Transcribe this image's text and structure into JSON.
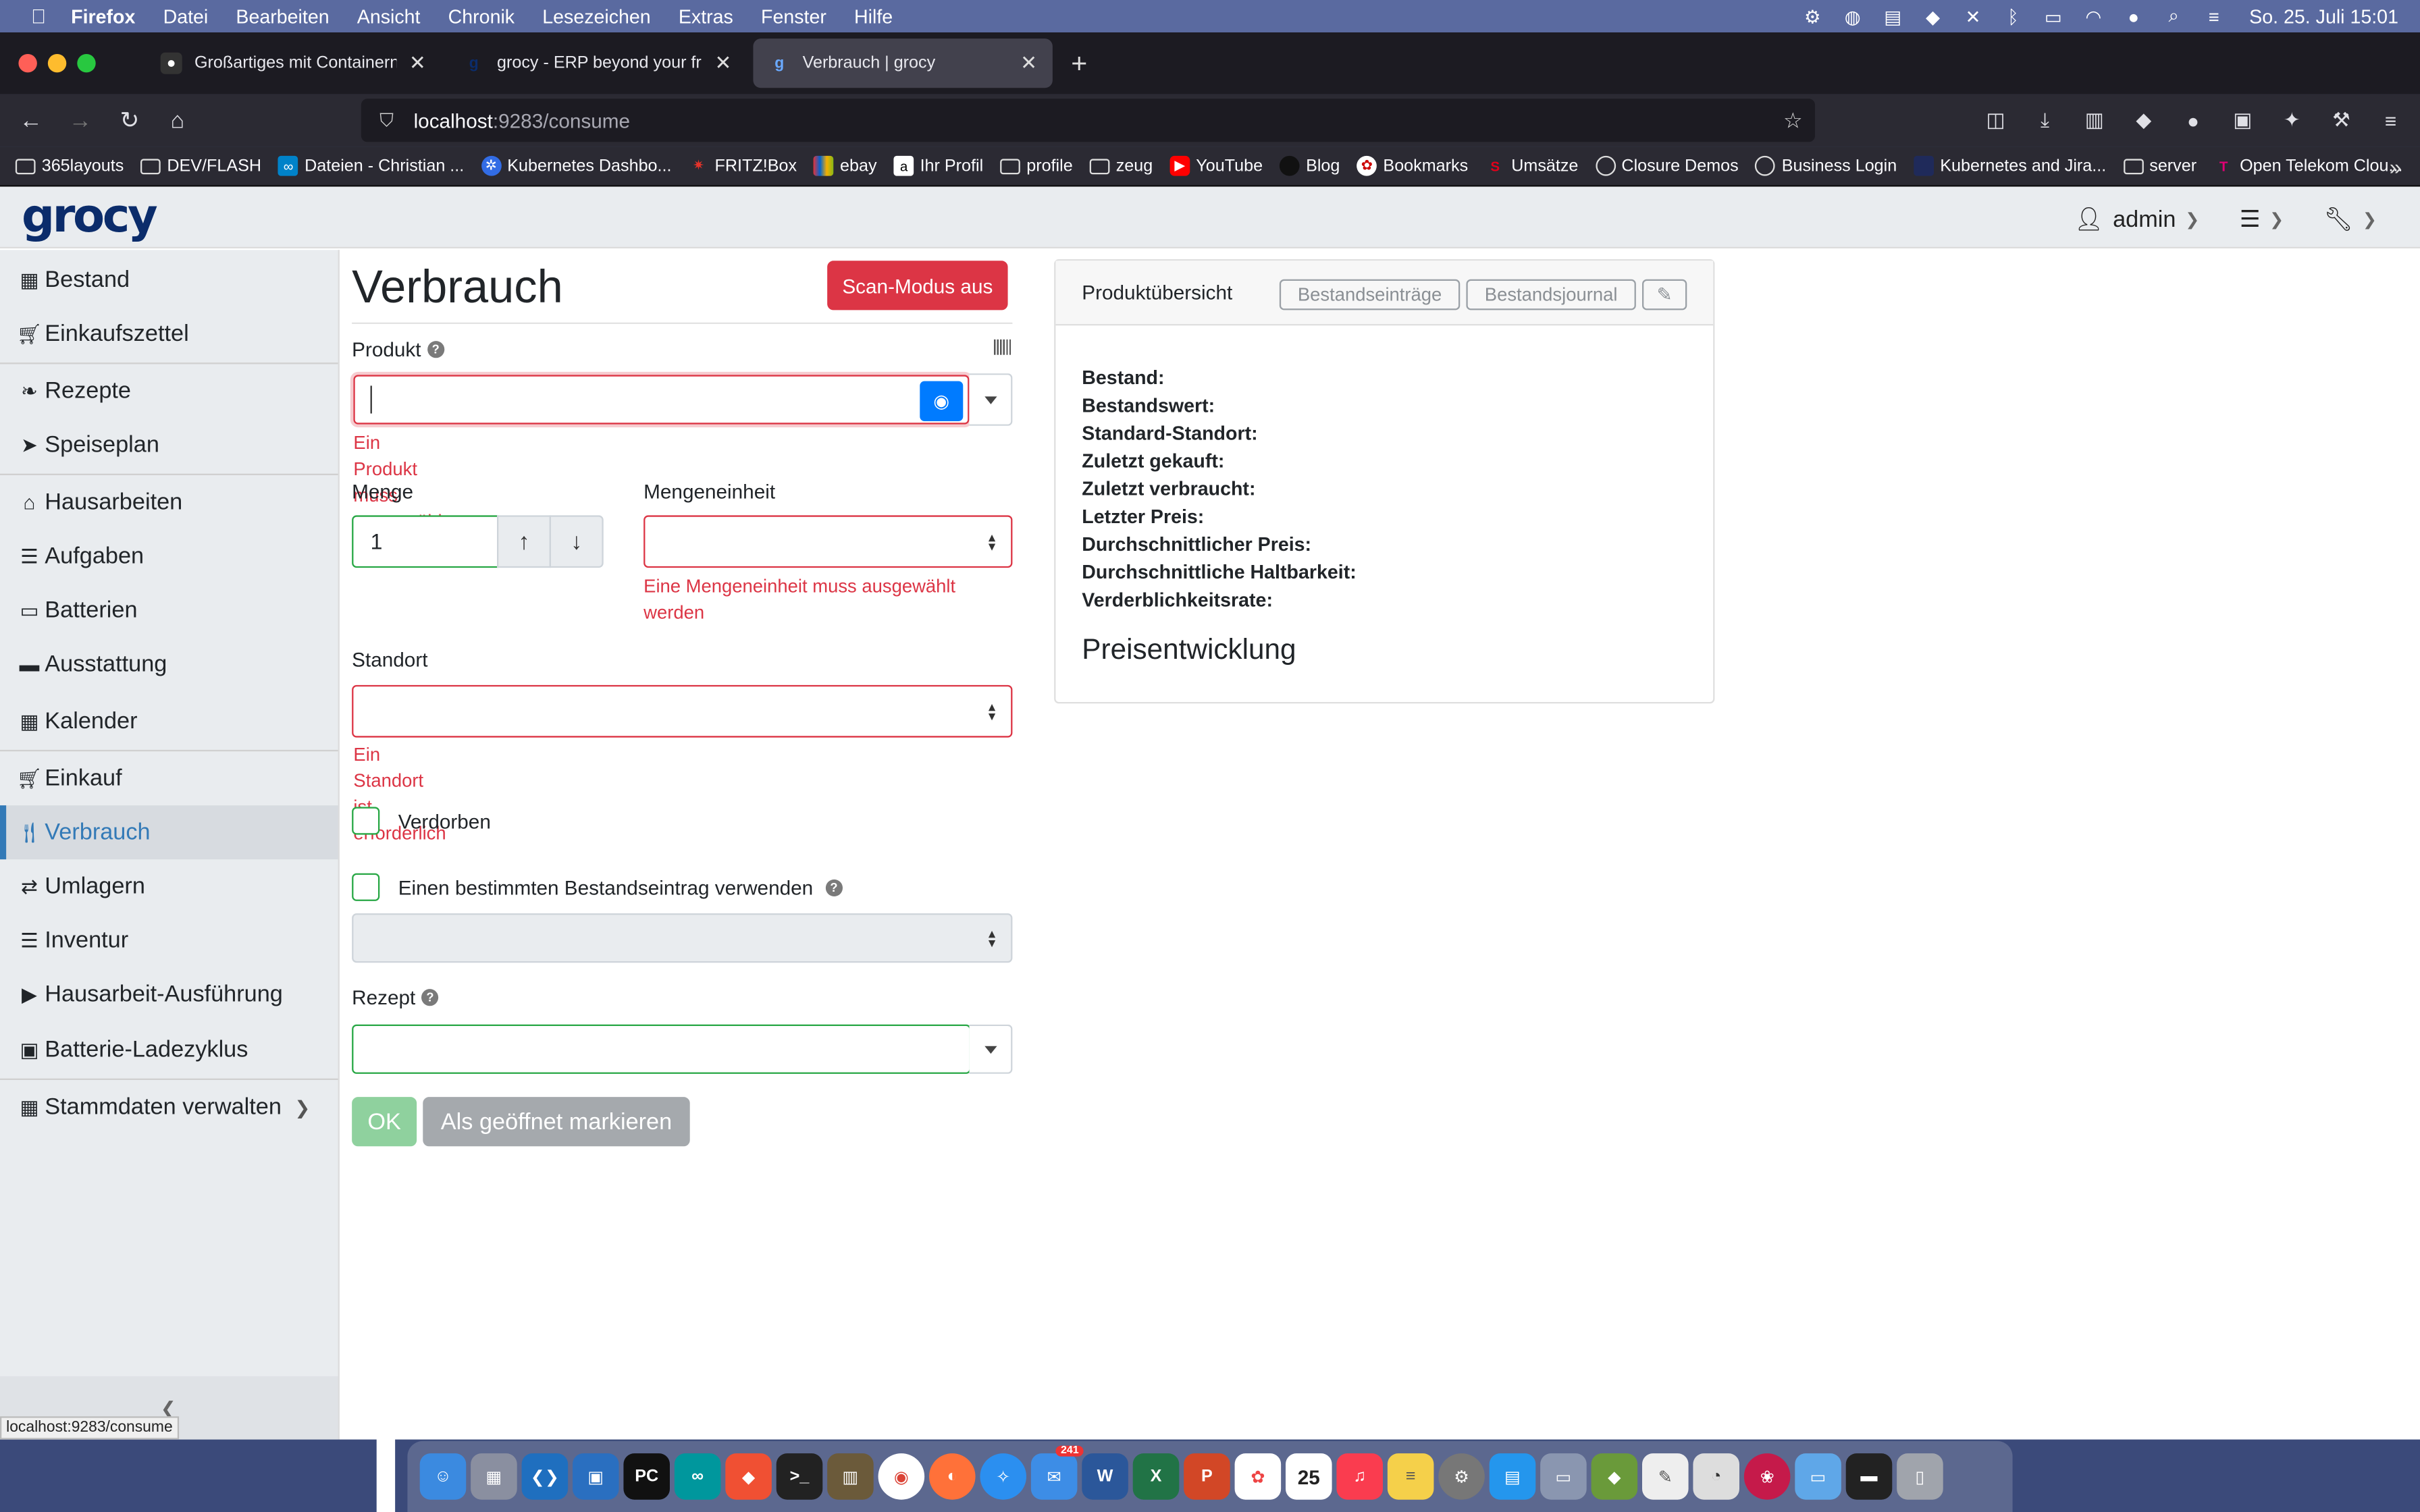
{
  "macos": {
    "menu": [
      "Firefox",
      "Datei",
      "Bearbeiten",
      "Ansicht",
      "Chronik",
      "Lesezeichen",
      "Extras",
      "Fenster",
      "Hilfe"
    ],
    "clock": "So. 25. Juli  15:01"
  },
  "tabs": [
    {
      "title": "Großartiges mit Containern: Kü",
      "active": false
    },
    {
      "title": "grocy - ERP beyond your fridge",
      "active": false
    },
    {
      "title": "Verbrauch | grocy",
      "active": true
    }
  ],
  "urlbar": {
    "host": "localhost",
    "path": ":9283/consume"
  },
  "bookmarks": [
    "365layouts",
    "DEV/FLASH",
    "Dateien - Christian ...",
    "Kubernetes Dashbo...",
    "FRITZ!Box",
    "ebay",
    "Ihr Profil",
    "profile",
    "zeug",
    "YouTube",
    "Blog",
    "Bookmarks",
    "Umsätze",
    "Closure Demos",
    "Business Login",
    "Kubernetes and Jira...",
    "server",
    "Open Telekom Clou..."
  ],
  "app": {
    "logo": "grocy",
    "user": "admin"
  },
  "sidebar": {
    "items": [
      {
        "label": "Bestand",
        "icon": "box-icon"
      },
      {
        "label": "Einkaufszettel",
        "icon": "cart-icon"
      },
      {
        "label": "Rezepte",
        "icon": "book-icon"
      },
      {
        "label": "Speiseplan",
        "icon": "paper-plane-icon"
      },
      {
        "label": "Hausarbeiten",
        "icon": "home-icon"
      },
      {
        "label": "Aufgaben",
        "icon": "tasks-icon"
      },
      {
        "label": "Batterien",
        "icon": "battery-icon"
      },
      {
        "label": "Ausstattung",
        "icon": "toolbox-icon"
      },
      {
        "label": "Kalender",
        "icon": "calendar-icon"
      },
      {
        "label": "Einkauf",
        "icon": "cart-plus-icon"
      },
      {
        "label": "Verbrauch",
        "icon": "utensils-icon"
      },
      {
        "label": "Umlagern",
        "icon": "exchange-icon"
      },
      {
        "label": "Inventur",
        "icon": "list-icon"
      },
      {
        "label": "Hausarbeit-Ausführung",
        "icon": "play-icon"
      },
      {
        "label": "Batterie-Ladezyklus",
        "icon": "car-battery-icon"
      },
      {
        "label": "Stammdaten verwalten",
        "icon": "table-icon"
      }
    ]
  },
  "form": {
    "title": "Verbrauch",
    "scan_button": "Scan-Modus aus",
    "product_label": "Produkt",
    "product_value": "",
    "product_error": "Ein Produkt muss ausgewählt werden",
    "amount_label": "Menge",
    "amount_value": "1",
    "unit_label": "Mengeneinheit",
    "unit_error": "Eine Mengeneinheit muss ausgewählt werden",
    "location_label": "Standort",
    "location_error": "Ein Standort ist erforderlich",
    "spoiled_label": "Verdorben",
    "specific_entry_label": "Einen bestimmten Bestandseintrag verwenden",
    "recipe_label": "Rezept",
    "recipe_value": "",
    "ok_button": "OK",
    "open_button": "Als geöffnet markieren"
  },
  "product_card": {
    "title": "Produktübersicht",
    "btn_entries": "Bestandseinträge",
    "btn_journal": "Bestandsjournal",
    "fields": [
      "Bestand:",
      "Bestandswert:",
      "Standard-Standort:",
      "Zuletzt gekauft:",
      "Zuletzt verbraucht:",
      "Letzter Preis:",
      "Durchschnittlicher Preis:",
      "Durchschnittliche Haltbarkeit:",
      "Verderblichkeitsrate:"
    ],
    "price_heading": "Preisentwicklung"
  },
  "status_url": "localhost:9283/consume",
  "dock_badge": "241",
  "calendar_day": "25"
}
